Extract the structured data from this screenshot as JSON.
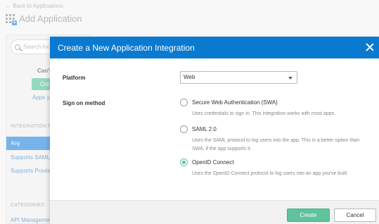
{
  "background": {
    "back_link": "← Back to Applications",
    "page_title": "Add Application",
    "sidebar": {
      "search_placeholder": "Search for a",
      "cant_text": "Can't",
      "create_button": "Cre",
      "apps_link": "Apps yo",
      "integration_section": "INTEGRATION PR",
      "filters": [
        "Any",
        "Supports SAML",
        "Supports Provisi"
      ],
      "categories_section": "CATEGORIES",
      "category_item": "API Management"
    }
  },
  "modal": {
    "title": "Create a New Application Integration",
    "platform_label": "Platform",
    "platform_value": "Web",
    "sign_on_label": "Sign on method",
    "options": [
      {
        "label": "Secure Web Authentication (SWA)",
        "description": "Uses credentials to sign in. This integration works with most apps.",
        "checked": false
      },
      {
        "label": "SAML 2.0",
        "description": "Uses the SAML protocol to log users into the app. This is a better option than SWA, if the app supports it.",
        "checked": false
      },
      {
        "label": "OpenID Connect",
        "description": "Uses the OpenID Connect protocol to log users into an app you've built.",
        "checked": true
      }
    ],
    "create_button": "Create",
    "cancel_button": "Cancel"
  },
  "colors": {
    "header_blue": "#0a7ad1",
    "accent_green": "#5fc39c",
    "filter_blue": "#2e8be0"
  }
}
